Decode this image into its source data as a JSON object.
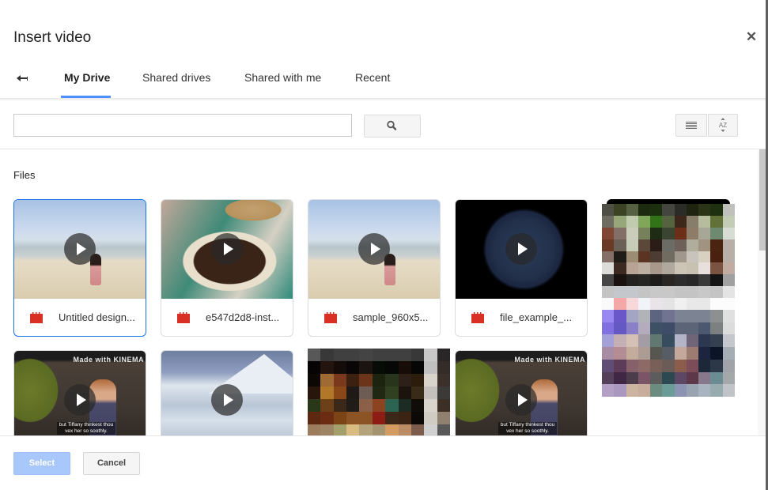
{
  "dialog": {
    "title": "Insert video",
    "close_icon": "close-icon"
  },
  "tabs": {
    "back_icon": "back-arrow-icon",
    "items": [
      {
        "label": "My Drive",
        "active": true
      },
      {
        "label": "Shared drives",
        "active": false
      },
      {
        "label": "Shared with me",
        "active": false
      },
      {
        "label": "Recent",
        "active": false
      }
    ]
  },
  "toolbar": {
    "search_value": "",
    "search_placeholder": "",
    "search_icon": "search-icon",
    "list_view_icon": "list-view-icon",
    "sort_icon": "sort-az-icon",
    "sort_label": "AZ"
  },
  "files": {
    "section_label": "Files",
    "items": [
      {
        "name": "Untitled design...",
        "type": "video",
        "selected": true,
        "thumbnail": "beach"
      },
      {
        "name": "e547d2d8-inst...",
        "type": "video",
        "selected": false,
        "thumbnail": "coffee"
      },
      {
        "name": "sample_960x5...",
        "type": "video",
        "selected": false,
        "thumbnail": "beach"
      },
      {
        "name": "file_example_...",
        "type": "video",
        "selected": false,
        "thumbnail": "earth"
      },
      {
        "name": "",
        "type": "video",
        "selected": false,
        "thumbnail": "pixelated"
      },
      {
        "name": "",
        "type": "video",
        "selected": false,
        "thumbnail": "movie-scene",
        "subtitle": "but Tiffany thinkest thou vex her so soothly.",
        "watermark": "Made with KINEMA"
      },
      {
        "name": "",
        "type": "video",
        "selected": false,
        "thumbnail": "glacier"
      },
      {
        "name": "",
        "type": "video",
        "selected": false,
        "thumbnail": "pixelated"
      },
      {
        "name": "",
        "type": "video",
        "selected": false,
        "thumbnail": "movie-scene",
        "subtitle": "but Tiffany thinkest thou vex her so soothly.",
        "watermark": "Made with KINEMA"
      },
      {
        "name": "",
        "type": "video",
        "selected": false,
        "thumbnail": "pixelated"
      }
    ]
  },
  "footer": {
    "select_label": "Select",
    "cancel_label": "Cancel"
  },
  "colors": {
    "accent": "#4d90fe",
    "selected_border": "#1a73e8",
    "select_button_disabled": "#a8c7fa",
    "video_icon": "#d93025"
  }
}
